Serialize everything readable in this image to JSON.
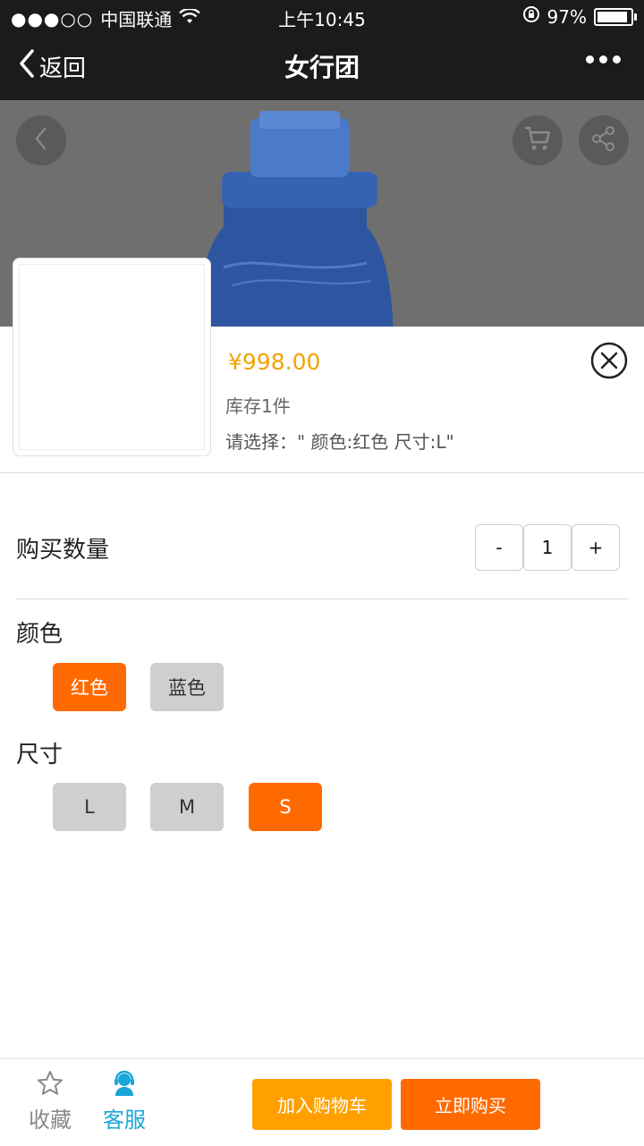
{
  "status": {
    "signal_dots": "●●●○○",
    "carrier": "中国联通",
    "wifi_icon": "wifi-icon",
    "time": "上午10:45",
    "battery": "97%",
    "battery_level": 0.97
  },
  "nav": {
    "back": "返回",
    "title": "女行团"
  },
  "product": {
    "price": "¥998.00",
    "stock": "库存1件",
    "selected": "请选择：\" 颜色:红色 尺寸:L\""
  },
  "quantity": {
    "label": "购买数量",
    "minus": "-",
    "value": "1",
    "plus": "+"
  },
  "color": {
    "label": "颜色",
    "options": [
      "红色",
      "蓝色"
    ],
    "selected_index": 0
  },
  "size": {
    "label": "尺寸",
    "options": [
      "L",
      "M",
      "S"
    ],
    "selected_index": 2
  },
  "bottom": {
    "favorite": "收藏",
    "service": "客服",
    "add_cart": "加入购物车",
    "buy_now": "立即购买"
  },
  "colors": {
    "accent_orange": "#ff6a00",
    "cart_orange": "#ffa000",
    "price_color": "#f2a300",
    "service_blue": "#1aa6d8"
  }
}
